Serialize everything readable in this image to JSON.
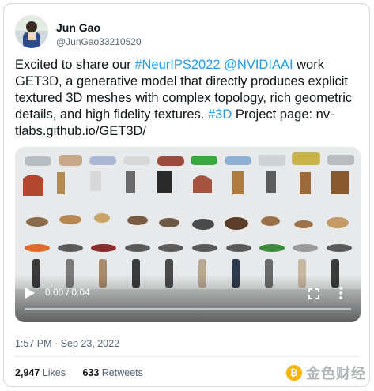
{
  "user": {
    "name": "Jun Gao",
    "handle": "@JunGao33210520"
  },
  "tweet": {
    "text_1": "Excited to share our ",
    "hashtag_neurips": "#NeurIPS2022",
    "mention_nvidia": "@NVIDIAAI",
    "text_2": " work GET3D, a generative model that directly produces explicit textured 3D meshes with complex topology, rich geometric details, and high fidelity textures. ",
    "hashtag_3d": "#3D",
    "text_3": " Project page: nv-tlabs.github.io/GET3D/"
  },
  "video": {
    "time_display": "0:00 / 0:04",
    "progress": 0.0
  },
  "meta": {
    "timestamp": "1:57 PM · Sep 23, 2022"
  },
  "stats": {
    "likes_count": "2,947",
    "likes_label": "Likes",
    "retweets_count": "633",
    "retweets_label": "Retweets"
  },
  "watermark": {
    "text": "金色财经"
  },
  "colors": {
    "link": "#1d9bf0",
    "secondary_text": "#536471"
  }
}
